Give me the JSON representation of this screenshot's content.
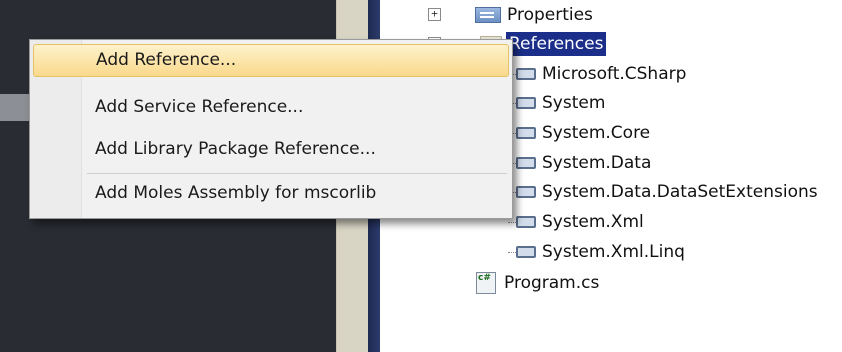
{
  "context_menu": {
    "items": [
      {
        "label": "Add Reference..."
      },
      {
        "label": "Add Service Reference..."
      },
      {
        "label": "Add Library Package Reference..."
      },
      {
        "label": "Add Moles Assembly for mscorlib"
      }
    ]
  },
  "solution_explorer": {
    "properties": {
      "label": "Properties",
      "expander": "+"
    },
    "references": {
      "label": "References"
    },
    "reference_items": [
      {
        "label": "Microsoft.CSharp"
      },
      {
        "label": "System"
      },
      {
        "label": "System.Core"
      },
      {
        "label": "System.Data"
      },
      {
        "label": "System.Data.DataSetExtensions"
      },
      {
        "label": "System.Xml"
      },
      {
        "label": "System.Xml.Linq"
      }
    ],
    "program_file": {
      "label": "Program.cs"
    }
  },
  "colors": {
    "selection": "#1b2f8a",
    "menu_highlight": "#fad98c",
    "editor_background": "#292c33"
  }
}
